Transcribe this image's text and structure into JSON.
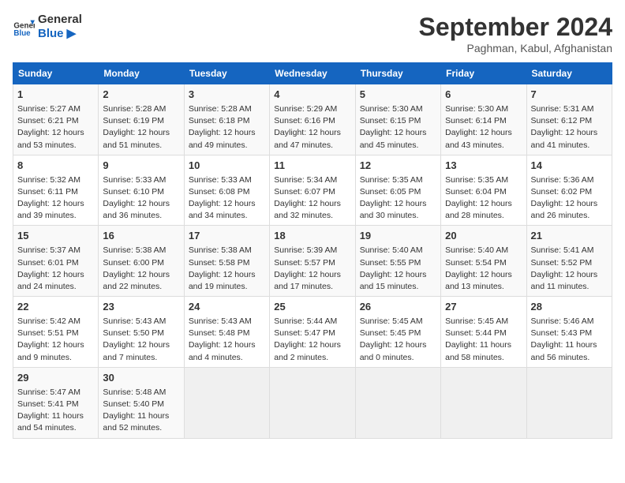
{
  "logo": {
    "line1": "General",
    "line2": "Blue"
  },
  "title": "September 2024",
  "location": "Paghman, Kabul, Afghanistan",
  "days_of_week": [
    "Sunday",
    "Monday",
    "Tuesday",
    "Wednesday",
    "Thursday",
    "Friday",
    "Saturday"
  ],
  "weeks": [
    [
      {
        "day": "1",
        "sunrise": "5:27 AM",
        "sunset": "6:21 PM",
        "daylight": "12 hours and 53 minutes."
      },
      {
        "day": "2",
        "sunrise": "5:28 AM",
        "sunset": "6:19 PM",
        "daylight": "12 hours and 51 minutes."
      },
      {
        "day": "3",
        "sunrise": "5:28 AM",
        "sunset": "6:18 PM",
        "daylight": "12 hours and 49 minutes."
      },
      {
        "day": "4",
        "sunrise": "5:29 AM",
        "sunset": "6:16 PM",
        "daylight": "12 hours and 47 minutes."
      },
      {
        "day": "5",
        "sunrise": "5:30 AM",
        "sunset": "6:15 PM",
        "daylight": "12 hours and 45 minutes."
      },
      {
        "day": "6",
        "sunrise": "5:30 AM",
        "sunset": "6:14 PM",
        "daylight": "12 hours and 43 minutes."
      },
      {
        "day": "7",
        "sunrise": "5:31 AM",
        "sunset": "6:12 PM",
        "daylight": "12 hours and 41 minutes."
      }
    ],
    [
      {
        "day": "8",
        "sunrise": "5:32 AM",
        "sunset": "6:11 PM",
        "daylight": "12 hours and 39 minutes."
      },
      {
        "day": "9",
        "sunrise": "5:33 AM",
        "sunset": "6:10 PM",
        "daylight": "12 hours and 36 minutes."
      },
      {
        "day": "10",
        "sunrise": "5:33 AM",
        "sunset": "6:08 PM",
        "daylight": "12 hours and 34 minutes."
      },
      {
        "day": "11",
        "sunrise": "5:34 AM",
        "sunset": "6:07 PM",
        "daylight": "12 hours and 32 minutes."
      },
      {
        "day": "12",
        "sunrise": "5:35 AM",
        "sunset": "6:05 PM",
        "daylight": "12 hours and 30 minutes."
      },
      {
        "day": "13",
        "sunrise": "5:35 AM",
        "sunset": "6:04 PM",
        "daylight": "12 hours and 28 minutes."
      },
      {
        "day": "14",
        "sunrise": "5:36 AM",
        "sunset": "6:02 PM",
        "daylight": "12 hours and 26 minutes."
      }
    ],
    [
      {
        "day": "15",
        "sunrise": "5:37 AM",
        "sunset": "6:01 PM",
        "daylight": "12 hours and 24 minutes."
      },
      {
        "day": "16",
        "sunrise": "5:38 AM",
        "sunset": "6:00 PM",
        "daylight": "12 hours and 22 minutes."
      },
      {
        "day": "17",
        "sunrise": "5:38 AM",
        "sunset": "5:58 PM",
        "daylight": "12 hours and 19 minutes."
      },
      {
        "day": "18",
        "sunrise": "5:39 AM",
        "sunset": "5:57 PM",
        "daylight": "12 hours and 17 minutes."
      },
      {
        "day": "19",
        "sunrise": "5:40 AM",
        "sunset": "5:55 PM",
        "daylight": "12 hours and 15 minutes."
      },
      {
        "day": "20",
        "sunrise": "5:40 AM",
        "sunset": "5:54 PM",
        "daylight": "12 hours and 13 minutes."
      },
      {
        "day": "21",
        "sunrise": "5:41 AM",
        "sunset": "5:52 PM",
        "daylight": "12 hours and 11 minutes."
      }
    ],
    [
      {
        "day": "22",
        "sunrise": "5:42 AM",
        "sunset": "5:51 PM",
        "daylight": "12 hours and 9 minutes."
      },
      {
        "day": "23",
        "sunrise": "5:43 AM",
        "sunset": "5:50 PM",
        "daylight": "12 hours and 7 minutes."
      },
      {
        "day": "24",
        "sunrise": "5:43 AM",
        "sunset": "5:48 PM",
        "daylight": "12 hours and 4 minutes."
      },
      {
        "day": "25",
        "sunrise": "5:44 AM",
        "sunset": "5:47 PM",
        "daylight": "12 hours and 2 minutes."
      },
      {
        "day": "26",
        "sunrise": "5:45 AM",
        "sunset": "5:45 PM",
        "daylight": "12 hours and 0 minutes."
      },
      {
        "day": "27",
        "sunrise": "5:45 AM",
        "sunset": "5:44 PM",
        "daylight": "11 hours and 58 minutes."
      },
      {
        "day": "28",
        "sunrise": "5:46 AM",
        "sunset": "5:43 PM",
        "daylight": "11 hours and 56 minutes."
      }
    ],
    [
      {
        "day": "29",
        "sunrise": "5:47 AM",
        "sunset": "5:41 PM",
        "daylight": "11 hours and 54 minutes."
      },
      {
        "day": "30",
        "sunrise": "5:48 AM",
        "sunset": "5:40 PM",
        "daylight": "11 hours and 52 minutes."
      },
      null,
      null,
      null,
      null,
      null
    ]
  ]
}
